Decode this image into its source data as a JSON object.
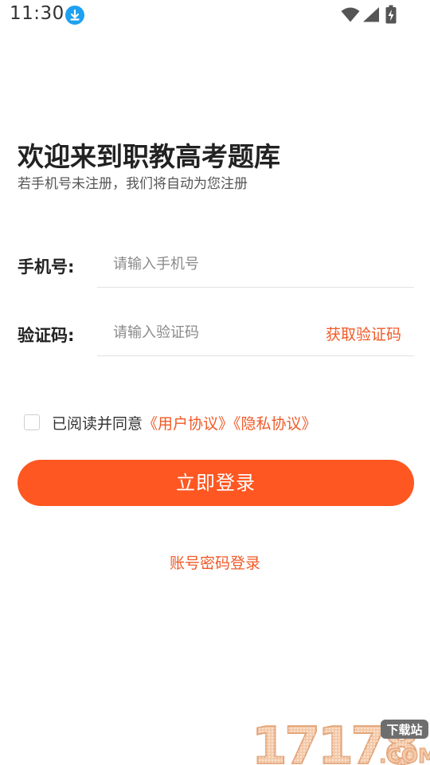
{
  "status_bar": {
    "time": "11:30",
    "icons": [
      "download-icon",
      "wifi-icon",
      "signal-icon",
      "battery-charging-icon"
    ]
  },
  "header": {
    "title": "欢迎来到职教高考题库",
    "subtitle": "若手机号未注册，我们将自动为您注册"
  },
  "form": {
    "phone": {
      "label": "手机号:",
      "placeholder": "请输入手机号",
      "value": ""
    },
    "code": {
      "label": "验证码:",
      "placeholder": "请输入验证码",
      "value": "",
      "get_code_label": "获取验证码"
    }
  },
  "agreement": {
    "checked": false,
    "prefix": "已阅读并同意",
    "user_agreement": "《用户协议》",
    "privacy_policy": "《隐私协议》"
  },
  "actions": {
    "login_label": "立即登录",
    "account_login_label": "账号密码登录"
  },
  "watermark": {
    "number": "17178",
    "tag": "下载站",
    "suffix": ".COM"
  },
  "colors": {
    "accent": "#fe5722",
    "link": "#f05a28",
    "download_badge": "#1ea1f2",
    "text": "#222222"
  }
}
